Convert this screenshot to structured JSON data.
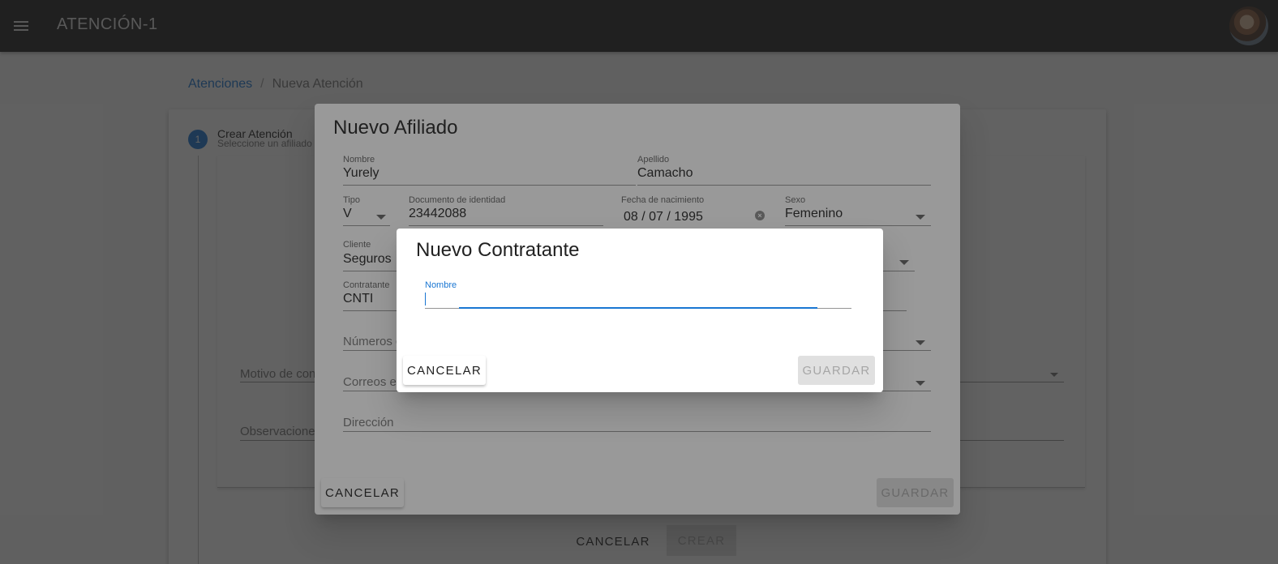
{
  "app": {
    "title": "ATENCIÓN-1"
  },
  "breadcrumb": {
    "root": "Atenciones",
    "separator": "/",
    "current": "Nueva Atención"
  },
  "stepper": {
    "step_number": "1",
    "step_title": "Crear Atención",
    "step_subtitle": "Seleccione un afiliado"
  },
  "background_form": {
    "motivo_label": "Motivo de cons",
    "observaciones_label": "Observaciones",
    "cancel_label": "CANCELAR",
    "create_label": "CREAR"
  },
  "afiliado_dialog": {
    "title": "Nuevo Afiliado",
    "fields": {
      "nombre": {
        "label": "Nombre",
        "value": "Yurely"
      },
      "apellido": {
        "label": "Apellido",
        "value": "Camacho"
      },
      "tipo": {
        "label": "Tipo",
        "value": "V"
      },
      "documento": {
        "label": "Documento de identidad",
        "value": "23442088"
      },
      "fecha": {
        "label": "Fecha de nacimiento",
        "value": "08 / 07 / 1995"
      },
      "sexo": {
        "label": "Sexo",
        "value": "Femenino"
      },
      "cliente": {
        "label": "Cliente",
        "value": "Seguros"
      },
      "contratante": {
        "label": "Contratante",
        "value": "CNTI"
      },
      "numeros": {
        "placeholder": "Números d"
      },
      "correos": {
        "placeholder": "Correos el"
      },
      "direccion": {
        "placeholder": "Dirección"
      }
    },
    "cancel_label": "CANCELAR",
    "save_label": "GUARDAR"
  },
  "contratante_dialog": {
    "title": "Nuevo Contratante",
    "nombre_label": "Nombre",
    "nombre_value": "",
    "cancel_label": "CANCELAR",
    "save_label": "GUARDAR"
  }
}
